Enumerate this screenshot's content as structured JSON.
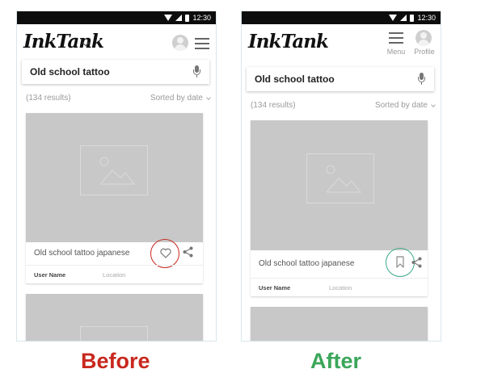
{
  "before": {
    "status_time": "12:30",
    "logo": "InkTank",
    "search": {
      "value": "Old school tattoo"
    },
    "results": {
      "count": "(134 results)",
      "sort": "Sorted by date"
    },
    "card": {
      "title": "Old school tattoo japanese",
      "user": "User Name",
      "location": "Location"
    },
    "action_icon": "heart-icon",
    "highlight_color": "#c8281e"
  },
  "after": {
    "status_time": "12:30",
    "logo": "InkTank",
    "nav": {
      "menu_label": "Menu",
      "profile_label": "Profile"
    },
    "search": {
      "value": "Old school tattoo"
    },
    "results": {
      "count": "(134 results)",
      "sort": "Sorted by date"
    },
    "card": {
      "title": "Old school tattoo japanese",
      "user": "User Name",
      "location": "Location"
    },
    "action_icon": "bookmark-icon",
    "highlight_color": "#3aa88a"
  },
  "labels": {
    "before": "Before",
    "after": "After"
  },
  "colors": {
    "before_label": "#c8281e",
    "after_label": "#3aa65a",
    "placeholder_gray": "#c8c8c8"
  }
}
